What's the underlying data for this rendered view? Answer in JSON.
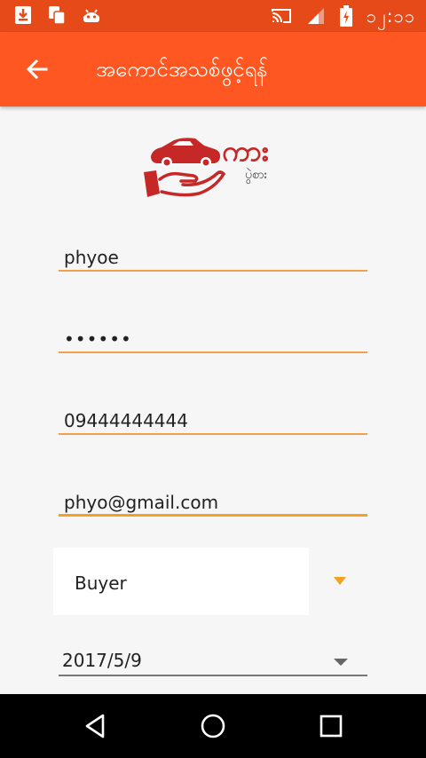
{
  "status_bar": {
    "time": "၁၂:၁၁",
    "icons": [
      "download-icon",
      "sim-icon",
      "android-icon",
      "cast-icon",
      "signal-icon",
      "battery-charging-icon"
    ]
  },
  "app_bar": {
    "title": "အကောင်အသစ်ဖွင့်ရန်",
    "back_icon": "arrow-back-icon"
  },
  "logo": {
    "text_main": "ကား",
    "text_sub": "ပွဲစား",
    "color": "#c62828"
  },
  "form": {
    "username": "phyoe",
    "password": "••••••",
    "phone": "09444444444",
    "email": "phyo@gmail.com",
    "role": "Buyer",
    "date": "2017/5/9"
  },
  "colors": {
    "status_bar": "#e64a19",
    "app_bar": "#ff5722",
    "accent": "#f5a020"
  },
  "nav_bar": {
    "icons": [
      "back-triangle-icon",
      "home-circle-icon",
      "recents-square-icon"
    ]
  }
}
